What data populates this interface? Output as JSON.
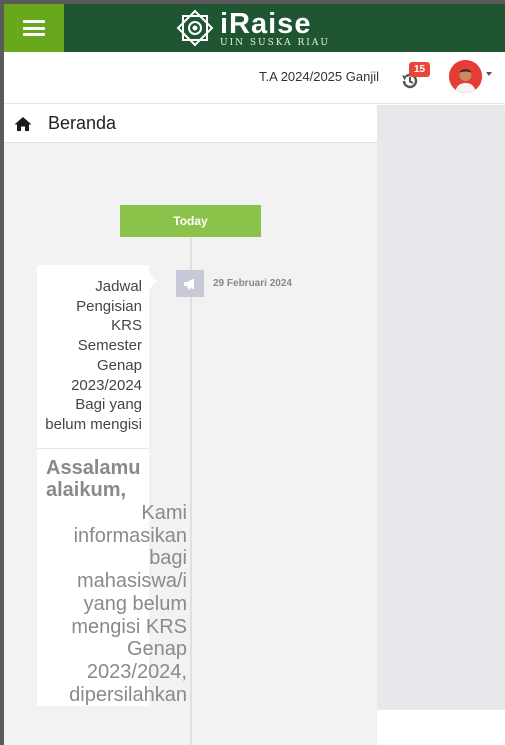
{
  "header": {
    "brand_title": "iRaise",
    "brand_subtitle": "UIN SUSKA RIAU",
    "logo_icon": "islamic-star-emblem",
    "menu_icon": "hamburger-menu",
    "colors": {
      "topbar": "#1f5631",
      "menu_button": "#67a81c"
    }
  },
  "navbar": {
    "term": "T.A 2024/2025 Ganjil",
    "notification_icon": "history-icon",
    "notification_count": "15",
    "avatar_icon": "user-avatar"
  },
  "breadcrumb": {
    "icon": "home-icon",
    "label": "Beranda"
  },
  "timeline": {
    "today_label": "Today",
    "today_color": "#8bc34a",
    "items": [
      {
        "icon": "megaphone-icon",
        "date": "29 Februari 2024",
        "title": "Jadwal Pengisian KRS Semester Genap 2023/2024 Bagi yang belum mengisi",
        "greeting": "Assalamu alaikum,",
        "body": "Kami informasikan bagi mahasiswa/i yang belum mengisi KRS Genap 2023/2024, dipersilahkan"
      }
    ]
  }
}
